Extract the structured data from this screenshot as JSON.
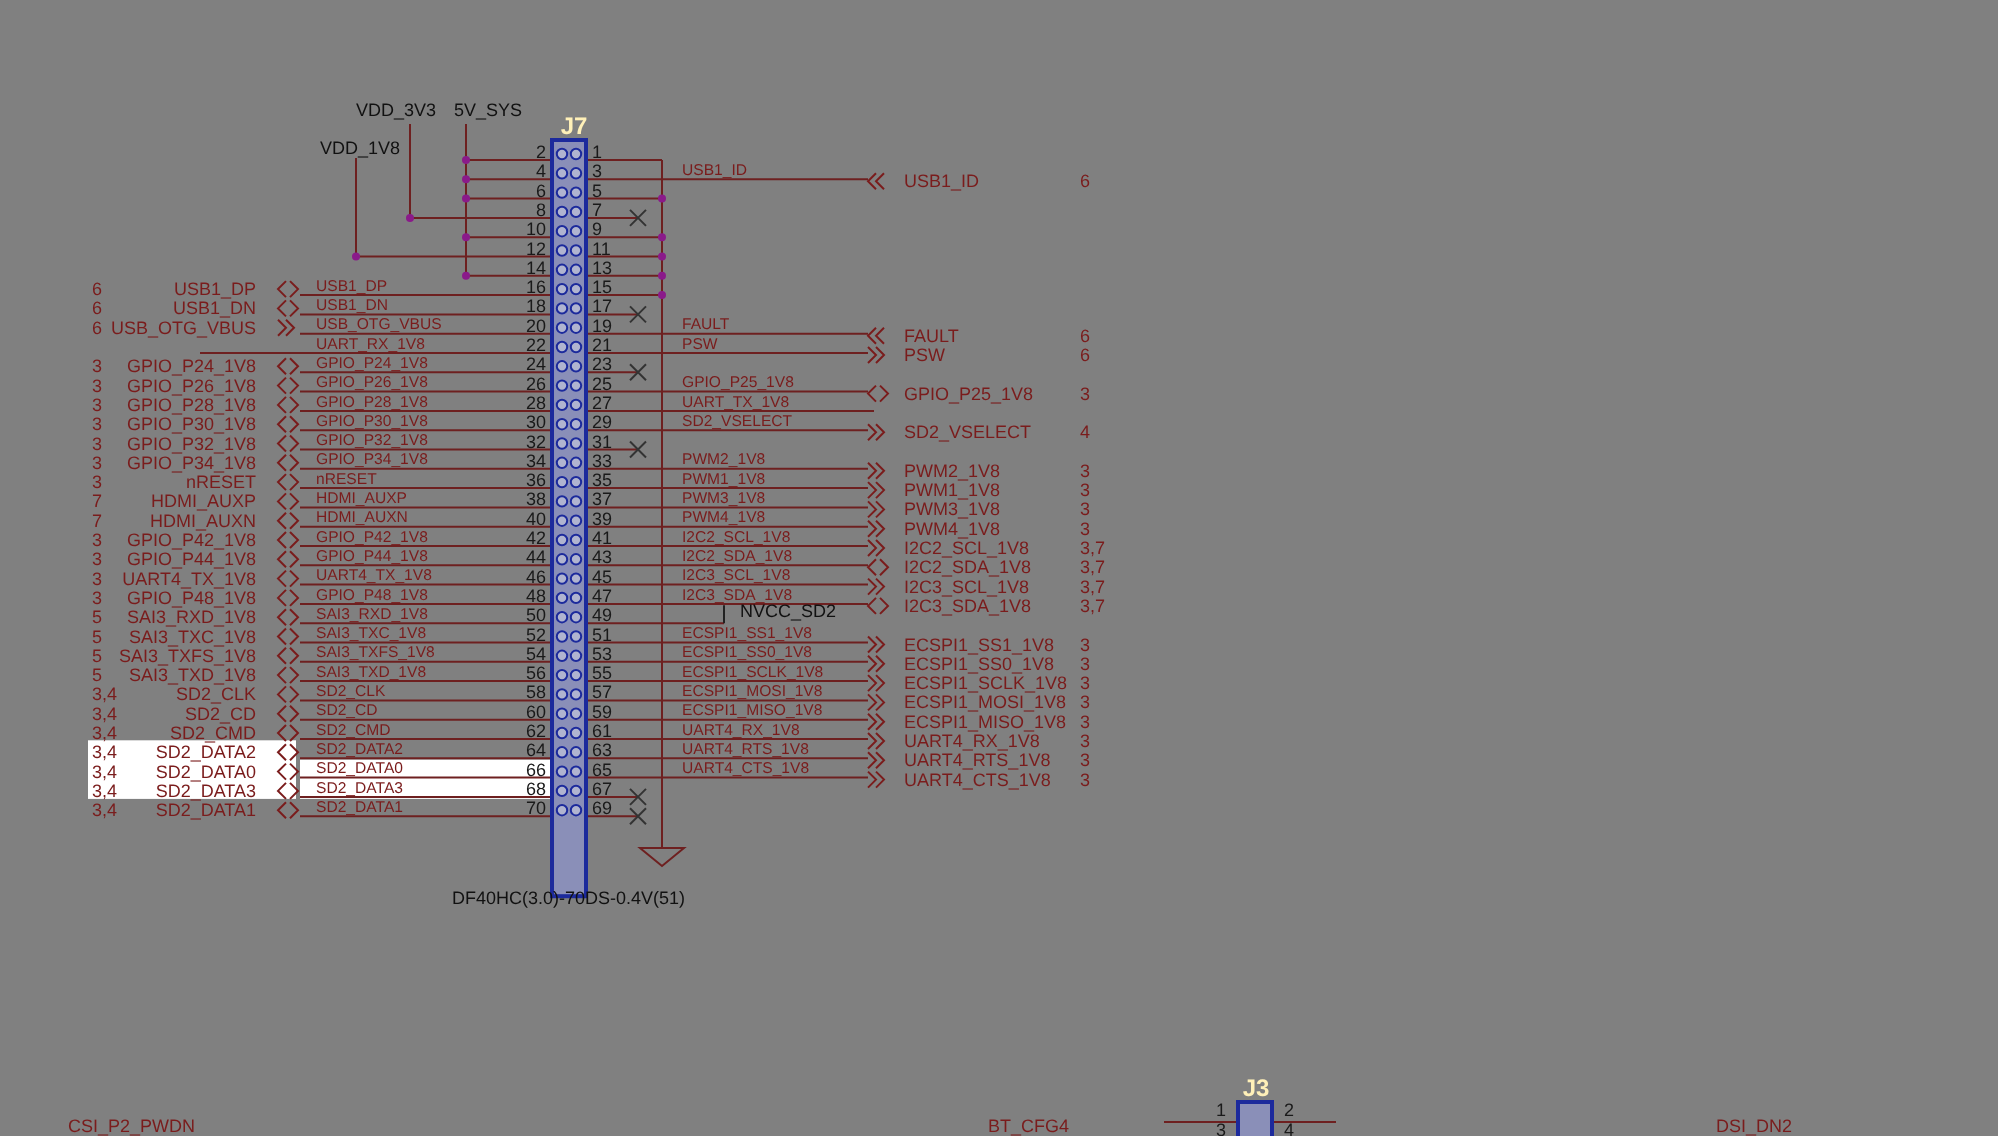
{
  "connector": {
    "ref": "J7",
    "part": "DF40HC(3.0)-70DS-0.4V(51)"
  },
  "power_nets": [
    {
      "name": "VDD_3V3"
    },
    {
      "name": "5V_SYS"
    },
    {
      "name": "VDD_1V8"
    }
  ],
  "rows": [
    {
      "left_pin": "2",
      "right_pin": "1",
      "left": {
        "kind": "power"
      },
      "right": {
        "kind": "power"
      }
    },
    {
      "left_pin": "4",
      "right_pin": "3",
      "left": {
        "kind": "power"
      },
      "right": {
        "kind": "signal",
        "net": "USB1_ID",
        "port": {
          "kind": "input",
          "label": "USB1_ID",
          "ref": "6"
        }
      }
    },
    {
      "left_pin": "6",
      "right_pin": "5",
      "left": {
        "kind": "power"
      },
      "right": {
        "kind": "power"
      }
    },
    {
      "left_pin": "8",
      "right_pin": "7",
      "left": {
        "kind": "power"
      },
      "right": {
        "kind": "no_connect"
      }
    },
    {
      "left_pin": "10",
      "right_pin": "9",
      "left": {
        "kind": "power"
      },
      "right": {
        "kind": "power"
      }
    },
    {
      "left_pin": "12",
      "right_pin": "11",
      "left": {
        "kind": "power"
      },
      "right": {
        "kind": "power"
      }
    },
    {
      "left_pin": "14",
      "right_pin": "13",
      "left": {
        "kind": "power"
      },
      "right": {
        "kind": "power"
      }
    },
    {
      "left_pin": "16",
      "right_pin": "15",
      "left": {
        "kind": "signal",
        "net": "USB1_DP",
        "port": {
          "kind": "bidir",
          "label": "USB1_DP",
          "ref": "6",
          "highlighted": false
        }
      },
      "right": {
        "kind": "power"
      }
    },
    {
      "left_pin": "18",
      "right_pin": "17",
      "left": {
        "kind": "signal",
        "net": "USB1_DN",
        "port": {
          "kind": "bidir",
          "label": "USB1_DN",
          "ref": "6",
          "highlighted": false
        }
      },
      "right": {
        "kind": "no_connect"
      }
    },
    {
      "left_pin": "20",
      "right_pin": "19",
      "left": {
        "kind": "signal",
        "net": "USB_OTG_VBUS",
        "port": {
          "kind": "input",
          "label": "USB_OTG_VBUS",
          "ref": "6",
          "highlighted": false
        }
      },
      "right": {
        "kind": "signal",
        "net": "FAULT",
        "port": {
          "kind": "input",
          "label": "FAULT",
          "ref": "6"
        }
      }
    },
    {
      "left_pin": "22",
      "right_pin": "21",
      "left": {
        "kind": "signal",
        "net": "UART_RX_1V8"
      },
      "right": {
        "kind": "signal",
        "net": "PSW",
        "port": {
          "kind": "output",
          "label": "PSW",
          "ref": "6"
        }
      }
    },
    {
      "left_pin": "24",
      "right_pin": "23",
      "left": {
        "kind": "signal",
        "net": "GPIO_P24_1V8",
        "port": {
          "kind": "bidir",
          "label": "GPIO_P24_1V8",
          "ref": "3",
          "highlighted": false
        }
      },
      "right": {
        "kind": "no_connect"
      }
    },
    {
      "left_pin": "26",
      "right_pin": "25",
      "left": {
        "kind": "signal",
        "net": "GPIO_P26_1V8",
        "port": {
          "kind": "bidir",
          "label": "GPIO_P26_1V8",
          "ref": "3",
          "highlighted": false
        }
      },
      "right": {
        "kind": "signal",
        "net": "GPIO_P25_1V8",
        "port": {
          "kind": "bidir",
          "label": "GPIO_P25_1V8",
          "ref": "3"
        }
      }
    },
    {
      "left_pin": "28",
      "right_pin": "27",
      "left": {
        "kind": "signal",
        "net": "GPIO_P28_1V8",
        "port": {
          "kind": "bidir",
          "label": "GPIO_P28_1V8",
          "ref": "3",
          "highlighted": false
        }
      },
      "right": {
        "kind": "signal",
        "net": "UART_TX_1V8"
      }
    },
    {
      "left_pin": "30",
      "right_pin": "29",
      "left": {
        "kind": "signal",
        "net": "GPIO_P30_1V8",
        "port": {
          "kind": "bidir",
          "label": "GPIO_P30_1V8",
          "ref": "3",
          "highlighted": false
        }
      },
      "right": {
        "kind": "signal",
        "net": "SD2_VSELECT",
        "port": {
          "kind": "output",
          "label": "SD2_VSELECT",
          "ref": "4"
        }
      }
    },
    {
      "left_pin": "32",
      "right_pin": "31",
      "left": {
        "kind": "signal",
        "net": "GPIO_P32_1V8",
        "port": {
          "kind": "bidir",
          "label": "GPIO_P32_1V8",
          "ref": "3",
          "highlighted": false
        }
      },
      "right": {
        "kind": "no_connect"
      }
    },
    {
      "left_pin": "34",
      "right_pin": "33",
      "left": {
        "kind": "signal",
        "net": "GPIO_P34_1V8",
        "port": {
          "kind": "bidir",
          "label": "GPIO_P34_1V8",
          "ref": "3",
          "highlighted": false
        }
      },
      "right": {
        "kind": "signal",
        "net": "PWM2_1V8",
        "port": {
          "kind": "output",
          "label": "PWM2_1V8",
          "ref": "3"
        }
      }
    },
    {
      "left_pin": "36",
      "right_pin": "35",
      "left": {
        "kind": "signal",
        "net": "nRESET",
        "port": {
          "kind": "bidir",
          "label": "nRESET",
          "ref": "3",
          "highlighted": false
        }
      },
      "right": {
        "kind": "signal",
        "net": "PWM1_1V8",
        "port": {
          "kind": "output",
          "label": "PWM1_1V8",
          "ref": "3"
        }
      }
    },
    {
      "left_pin": "38",
      "right_pin": "37",
      "left": {
        "kind": "signal",
        "net": "HDMI_AUXP",
        "port": {
          "kind": "bidir",
          "label": "HDMI_AUXP",
          "ref": "7",
          "highlighted": false
        }
      },
      "right": {
        "kind": "signal",
        "net": "PWM3_1V8",
        "port": {
          "kind": "output",
          "label": "PWM3_1V8",
          "ref": "3"
        }
      }
    },
    {
      "left_pin": "40",
      "right_pin": "39",
      "left": {
        "kind": "signal",
        "net": "HDMI_AUXN",
        "port": {
          "kind": "bidir",
          "label": "HDMI_AUXN",
          "ref": "7",
          "highlighted": false
        }
      },
      "right": {
        "kind": "signal",
        "net": "PWM4_1V8",
        "port": {
          "kind": "output",
          "label": "PWM4_1V8",
          "ref": "3"
        }
      }
    },
    {
      "left_pin": "42",
      "right_pin": "41",
      "left": {
        "kind": "signal",
        "net": "GPIO_P42_1V8",
        "port": {
          "kind": "bidir",
          "label": "GPIO_P42_1V8",
          "ref": "3",
          "highlighted": false
        }
      },
      "right": {
        "kind": "signal",
        "net": "I2C2_SCL_1V8",
        "port": {
          "kind": "output",
          "label": "I2C2_SCL_1V8",
          "ref": "3,7"
        }
      }
    },
    {
      "left_pin": "44",
      "right_pin": "43",
      "left": {
        "kind": "signal",
        "net": "GPIO_P44_1V8",
        "port": {
          "kind": "bidir",
          "label": "GPIO_P44_1V8",
          "ref": "3",
          "highlighted": false
        }
      },
      "right": {
        "kind": "signal",
        "net": "I2C2_SDA_1V8",
        "port": {
          "kind": "bidir",
          "label": "I2C2_SDA_1V8",
          "ref": "3,7"
        }
      }
    },
    {
      "left_pin": "46",
      "right_pin": "45",
      "left": {
        "kind": "signal",
        "net": "UART4_TX_1V8",
        "port": {
          "kind": "bidir",
          "label": "UART4_TX_1V8",
          "ref": "3",
          "highlighted": false
        }
      },
      "right": {
        "kind": "signal",
        "net": "I2C3_SCL_1V8",
        "port": {
          "kind": "output",
          "label": "I2C3_SCL_1V8",
          "ref": "3,7"
        }
      }
    },
    {
      "left_pin": "48",
      "right_pin": "47",
      "left": {
        "kind": "signal",
        "net": "GPIO_P48_1V8",
        "port": {
          "kind": "bidir",
          "label": "GPIO_P48_1V8",
          "ref": "3",
          "highlighted": false
        }
      },
      "right": {
        "kind": "signal",
        "net": "I2C3_SDA_1V8",
        "port": {
          "kind": "bidir",
          "label": "I2C3_SDA_1V8",
          "ref": "3,7"
        }
      }
    },
    {
      "left_pin": "50",
      "right_pin": "49",
      "left": {
        "kind": "signal",
        "net": "SAI3_RXD_1V8",
        "port": {
          "kind": "bidir",
          "label": "SAI3_RXD_1V8",
          "ref": "5",
          "highlighted": false
        }
      },
      "right": {
        "kind": "supply",
        "label": "NVCC_SD2"
      }
    },
    {
      "left_pin": "52",
      "right_pin": "51",
      "left": {
        "kind": "signal",
        "net": "SAI3_TXC_1V8",
        "port": {
          "kind": "bidir",
          "label": "SAI3_TXC_1V8",
          "ref": "5",
          "highlighted": false
        }
      },
      "right": {
        "kind": "signal",
        "net": "ECSPI1_SS1_1V8",
        "port": {
          "kind": "output",
          "label": "ECSPI1_SS1_1V8",
          "ref": "3"
        }
      }
    },
    {
      "left_pin": "54",
      "right_pin": "53",
      "left": {
        "kind": "signal",
        "net": "SAI3_TXFS_1V8",
        "port": {
          "kind": "bidir",
          "label": "SAI3_TXFS_1V8",
          "ref": "5",
          "highlighted": false
        }
      },
      "right": {
        "kind": "signal",
        "net": "ECSPI1_SS0_1V8",
        "port": {
          "kind": "output",
          "label": "ECSPI1_SS0_1V8",
          "ref": "3"
        }
      }
    },
    {
      "left_pin": "56",
      "right_pin": "55",
      "left": {
        "kind": "signal",
        "net": "SAI3_TXD_1V8",
        "port": {
          "kind": "bidir",
          "label": "SAI3_TXD_1V8",
          "ref": "5",
          "highlighted": false
        }
      },
      "right": {
        "kind": "signal",
        "net": "ECSPI1_SCLK_1V8",
        "port": {
          "kind": "output",
          "label": "ECSPI1_SCLK_1V8",
          "ref": "3"
        }
      }
    },
    {
      "left_pin": "58",
      "right_pin": "57",
      "left": {
        "kind": "signal",
        "net": "SD2_CLK",
        "port": {
          "kind": "bidir",
          "label": "SD2_CLK",
          "ref": "3,4",
          "highlighted": false
        }
      },
      "right": {
        "kind": "signal",
        "net": "ECSPI1_MOSI_1V8",
        "port": {
          "kind": "output",
          "label": "ECSPI1_MOSI_1V8",
          "ref": "3"
        }
      }
    },
    {
      "left_pin": "60",
      "right_pin": "59",
      "left": {
        "kind": "signal",
        "net": "SD2_CD",
        "port": {
          "kind": "bidir",
          "label": "SD2_CD",
          "ref": "3,4",
          "highlighted": false
        }
      },
      "right": {
        "kind": "signal",
        "net": "ECSPI1_MISO_1V8",
        "port": {
          "kind": "output",
          "label": "ECSPI1_MISO_1V8",
          "ref": "3"
        }
      }
    },
    {
      "left_pin": "62",
      "right_pin": "61",
      "left": {
        "kind": "signal",
        "net": "SD2_CMD",
        "port": {
          "kind": "bidir",
          "label": "SD2_CMD",
          "ref": "3,4",
          "highlighted": false
        }
      },
      "right": {
        "kind": "signal",
        "net": "UART4_RX_1V8",
        "port": {
          "kind": "output",
          "label": "UART4_RX_1V8",
          "ref": "3"
        }
      }
    },
    {
      "left_pin": "64",
      "right_pin": "63",
      "left": {
        "kind": "signal",
        "net": "SD2_DATA2",
        "port": {
          "kind": "bidir",
          "label": "SD2_DATA2",
          "ref": "3,4",
          "highlighted": true
        }
      },
      "right": {
        "kind": "signal",
        "net": "UART4_RTS_1V8",
        "port": {
          "kind": "output",
          "label": "UART4_RTS_1V8",
          "ref": "3"
        }
      }
    },
    {
      "left_pin": "66",
      "right_pin": "65",
      "left": {
        "kind": "signal",
        "net": "SD2_DATA0",
        "highlighted": true,
        "port": {
          "kind": "bidir",
          "label": "SD2_DATA0",
          "ref": "3,4",
          "highlighted": true
        }
      },
      "right": {
        "kind": "signal",
        "net": "UART4_CTS_1V8",
        "port": {
          "kind": "output",
          "label": "UART4_CTS_1V8",
          "ref": "3"
        }
      }
    },
    {
      "left_pin": "68",
      "right_pin": "67",
      "left": {
        "kind": "signal",
        "net": "SD2_DATA3",
        "highlighted": true,
        "port": {
          "kind": "bidir",
          "label": "SD2_DATA3",
          "ref": "3,4",
          "highlighted": true
        }
      },
      "right": {
        "kind": "no_connect"
      }
    },
    {
      "left_pin": "70",
      "right_pin": "69",
      "left": {
        "kind": "signal",
        "net": "SD2_DATA1",
        "port": {
          "kind": "bidir",
          "label": "SD2_DATA1",
          "ref": "3,4",
          "highlighted": false
        }
      },
      "right": {
        "kind": "no_connect"
      }
    }
  ],
  "bottom_strip": {
    "left_net": "CSI_P2_PWDN",
    "mid_net": "BT_CFG4",
    "connector_ref": "J3",
    "pins": [
      "1",
      "2",
      "3",
      "4"
    ],
    "right_net": "DSI_DN2"
  }
}
